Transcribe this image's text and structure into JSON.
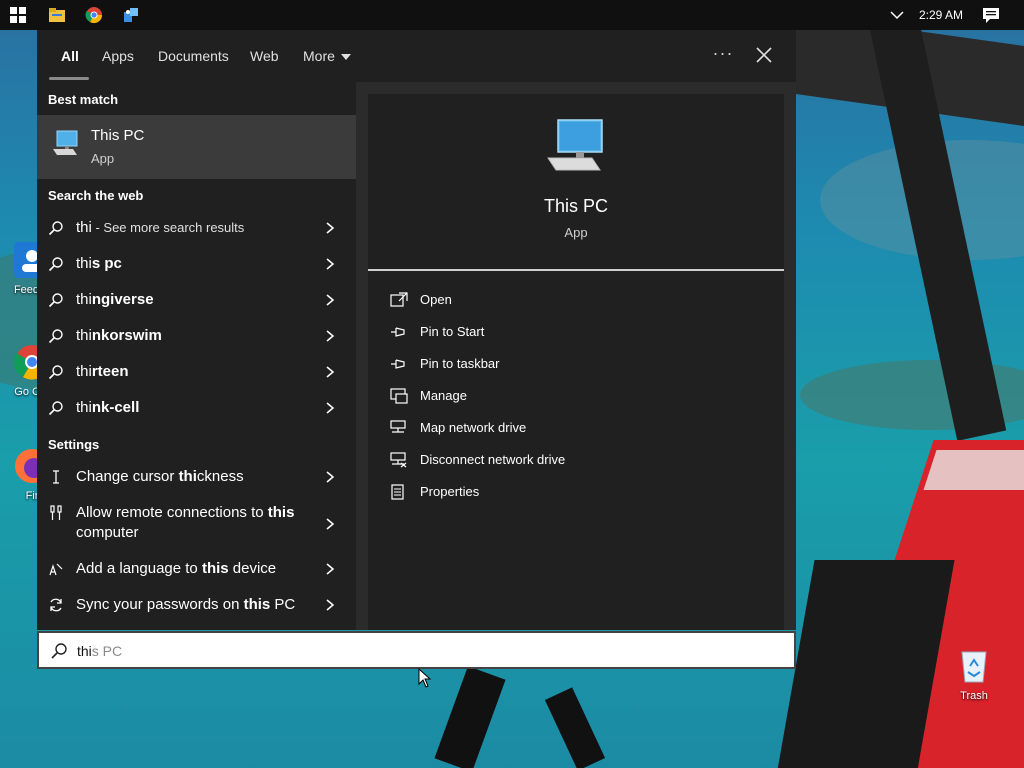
{
  "taskbar": {
    "clock": "2:29 AM",
    "icons": [
      "windows-start-icon",
      "file-explorer-icon",
      "chrome-icon",
      "app-icon"
    ]
  },
  "desktop": {
    "left_icons": [
      {
        "label": "Feed H",
        "icon": "feedback-hub-icon"
      },
      {
        "label": "Go Chr",
        "icon": "chrome-icon"
      },
      {
        "label": "Fir",
        "icon": "firefox-icon"
      }
    ],
    "trash_label": "Trash"
  },
  "search_panel": {
    "tabs": [
      {
        "label": "All",
        "active": true
      },
      {
        "label": "Apps"
      },
      {
        "label": "Documents"
      },
      {
        "label": "Web"
      },
      {
        "label": "More"
      }
    ],
    "ellipsis": "···",
    "sections": {
      "best_match": "Best match",
      "search_web": "Search the web",
      "settings": "Settings"
    },
    "best_match": {
      "title": "This PC",
      "subtitle": "App"
    },
    "web_results": [
      {
        "prefix": "thi",
        "suffix": " - See more search results"
      },
      {
        "prefix": "thi",
        "bold": "s pc"
      },
      {
        "prefix": "thi",
        "bold": "ngiverse"
      },
      {
        "prefix": "thi",
        "bold": "nkorswim"
      },
      {
        "prefix": "thi",
        "bold": "rteen"
      },
      {
        "prefix": "thi",
        "bold": "nk-cell"
      }
    ],
    "settings_results": [
      {
        "icon": "cursor-icon",
        "pre": "Change cursor ",
        "bold": "thi",
        "post": "ckness"
      },
      {
        "icon": "remote-icon",
        "pre": "Allow remote connections to ",
        "bold": "this",
        "post": " computer"
      },
      {
        "icon": "language-icon",
        "pre": "Add a language to ",
        "bold": "this",
        "post": " device"
      },
      {
        "icon": "sync-icon",
        "pre": "Sync your passwords on ",
        "bold": "this",
        "post": " PC"
      }
    ],
    "detail": {
      "title": "This PC",
      "subtitle": "App",
      "actions": [
        "Open",
        "Pin to Start",
        "Pin to taskbar",
        "Manage",
        "Map network drive",
        "Disconnect network drive",
        "Properties"
      ]
    }
  },
  "search_box": {
    "typed": "thi",
    "suggestion": "s PC"
  },
  "colors": {
    "panel_bg": "#202020",
    "highlight_bg": "#3b3b3b",
    "taskbar_bg": "#101010"
  }
}
